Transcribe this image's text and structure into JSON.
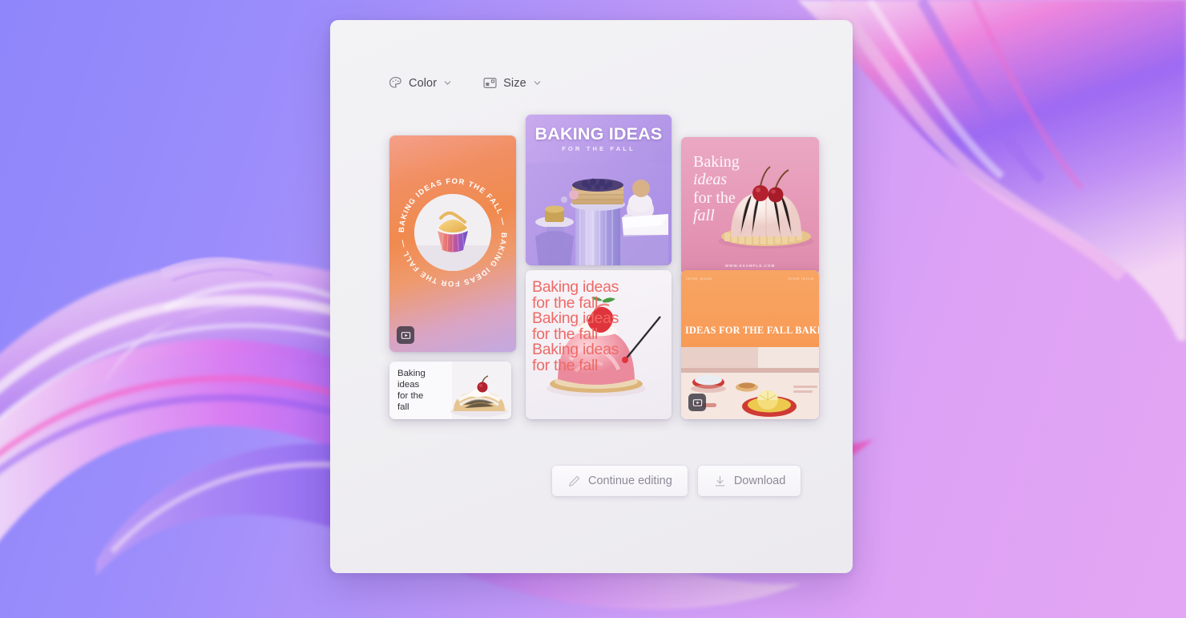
{
  "background": {
    "gradient_from": "#8f86fb",
    "gradient_to": "#e3a6f4",
    "swirl_colors": [
      "#7a5af0",
      "#b184f2",
      "#f05ec8",
      "#f7d9ef",
      "#c9a8f5"
    ]
  },
  "panel": {
    "background": "#f1f0f3"
  },
  "toolbar": {
    "color_label": "Color",
    "color_icon": "palette-icon",
    "size_label": "Size",
    "size_icon": "resize-frame-icon",
    "chevron_icon": "chevron-down-icon"
  },
  "results": {
    "cards": [
      {
        "id": "orange-circular",
        "type": "story",
        "ring_text": "BAKING IDEAS FOR THE FALL —",
        "has_video_badge": true,
        "badge_icon": "video-play-icon",
        "accent": "#f08a4e"
      },
      {
        "id": "purple-hero",
        "type": "square",
        "title": "BAKING IDEAS",
        "subtitle": "FOR THE FALL",
        "has_video_badge": false,
        "accent": "#ab8ee4"
      },
      {
        "id": "pink-dome",
        "type": "square",
        "line1": "Baking",
        "line2": "ideas",
        "line3": "for the",
        "line4": "fall",
        "url": "WWW.EXAMPLE.COM",
        "has_video_badge": false,
        "accent": "#e292b2"
      },
      {
        "id": "red-repeat",
        "type": "square",
        "repeat_line_a": "Baking ideas",
        "repeat_line_b": "for the fall",
        "repeat_count": 3,
        "has_video_badge": false,
        "accent": "#ee6a66"
      },
      {
        "id": "orange-marquee",
        "type": "square",
        "marquee_text": "IDEAS FOR THE FALL    BAKING",
        "corner_left": "lorem ipsum",
        "corner_right": "lorem ipsum",
        "has_video_badge": true,
        "badge_icon": "video-play-icon",
        "accent": "#f89f5c"
      },
      {
        "id": "white-landscape",
        "type": "landscape",
        "line1": "Baking",
        "line2": "ideas",
        "line3": "for the",
        "line4": "fall",
        "has_video_badge": false,
        "accent": "#33333a"
      }
    ]
  },
  "footer": {
    "continue_label": "Continue editing",
    "continue_icon": "pencil-icon",
    "download_label": "Download",
    "download_icon": "download-arrow-icon"
  }
}
